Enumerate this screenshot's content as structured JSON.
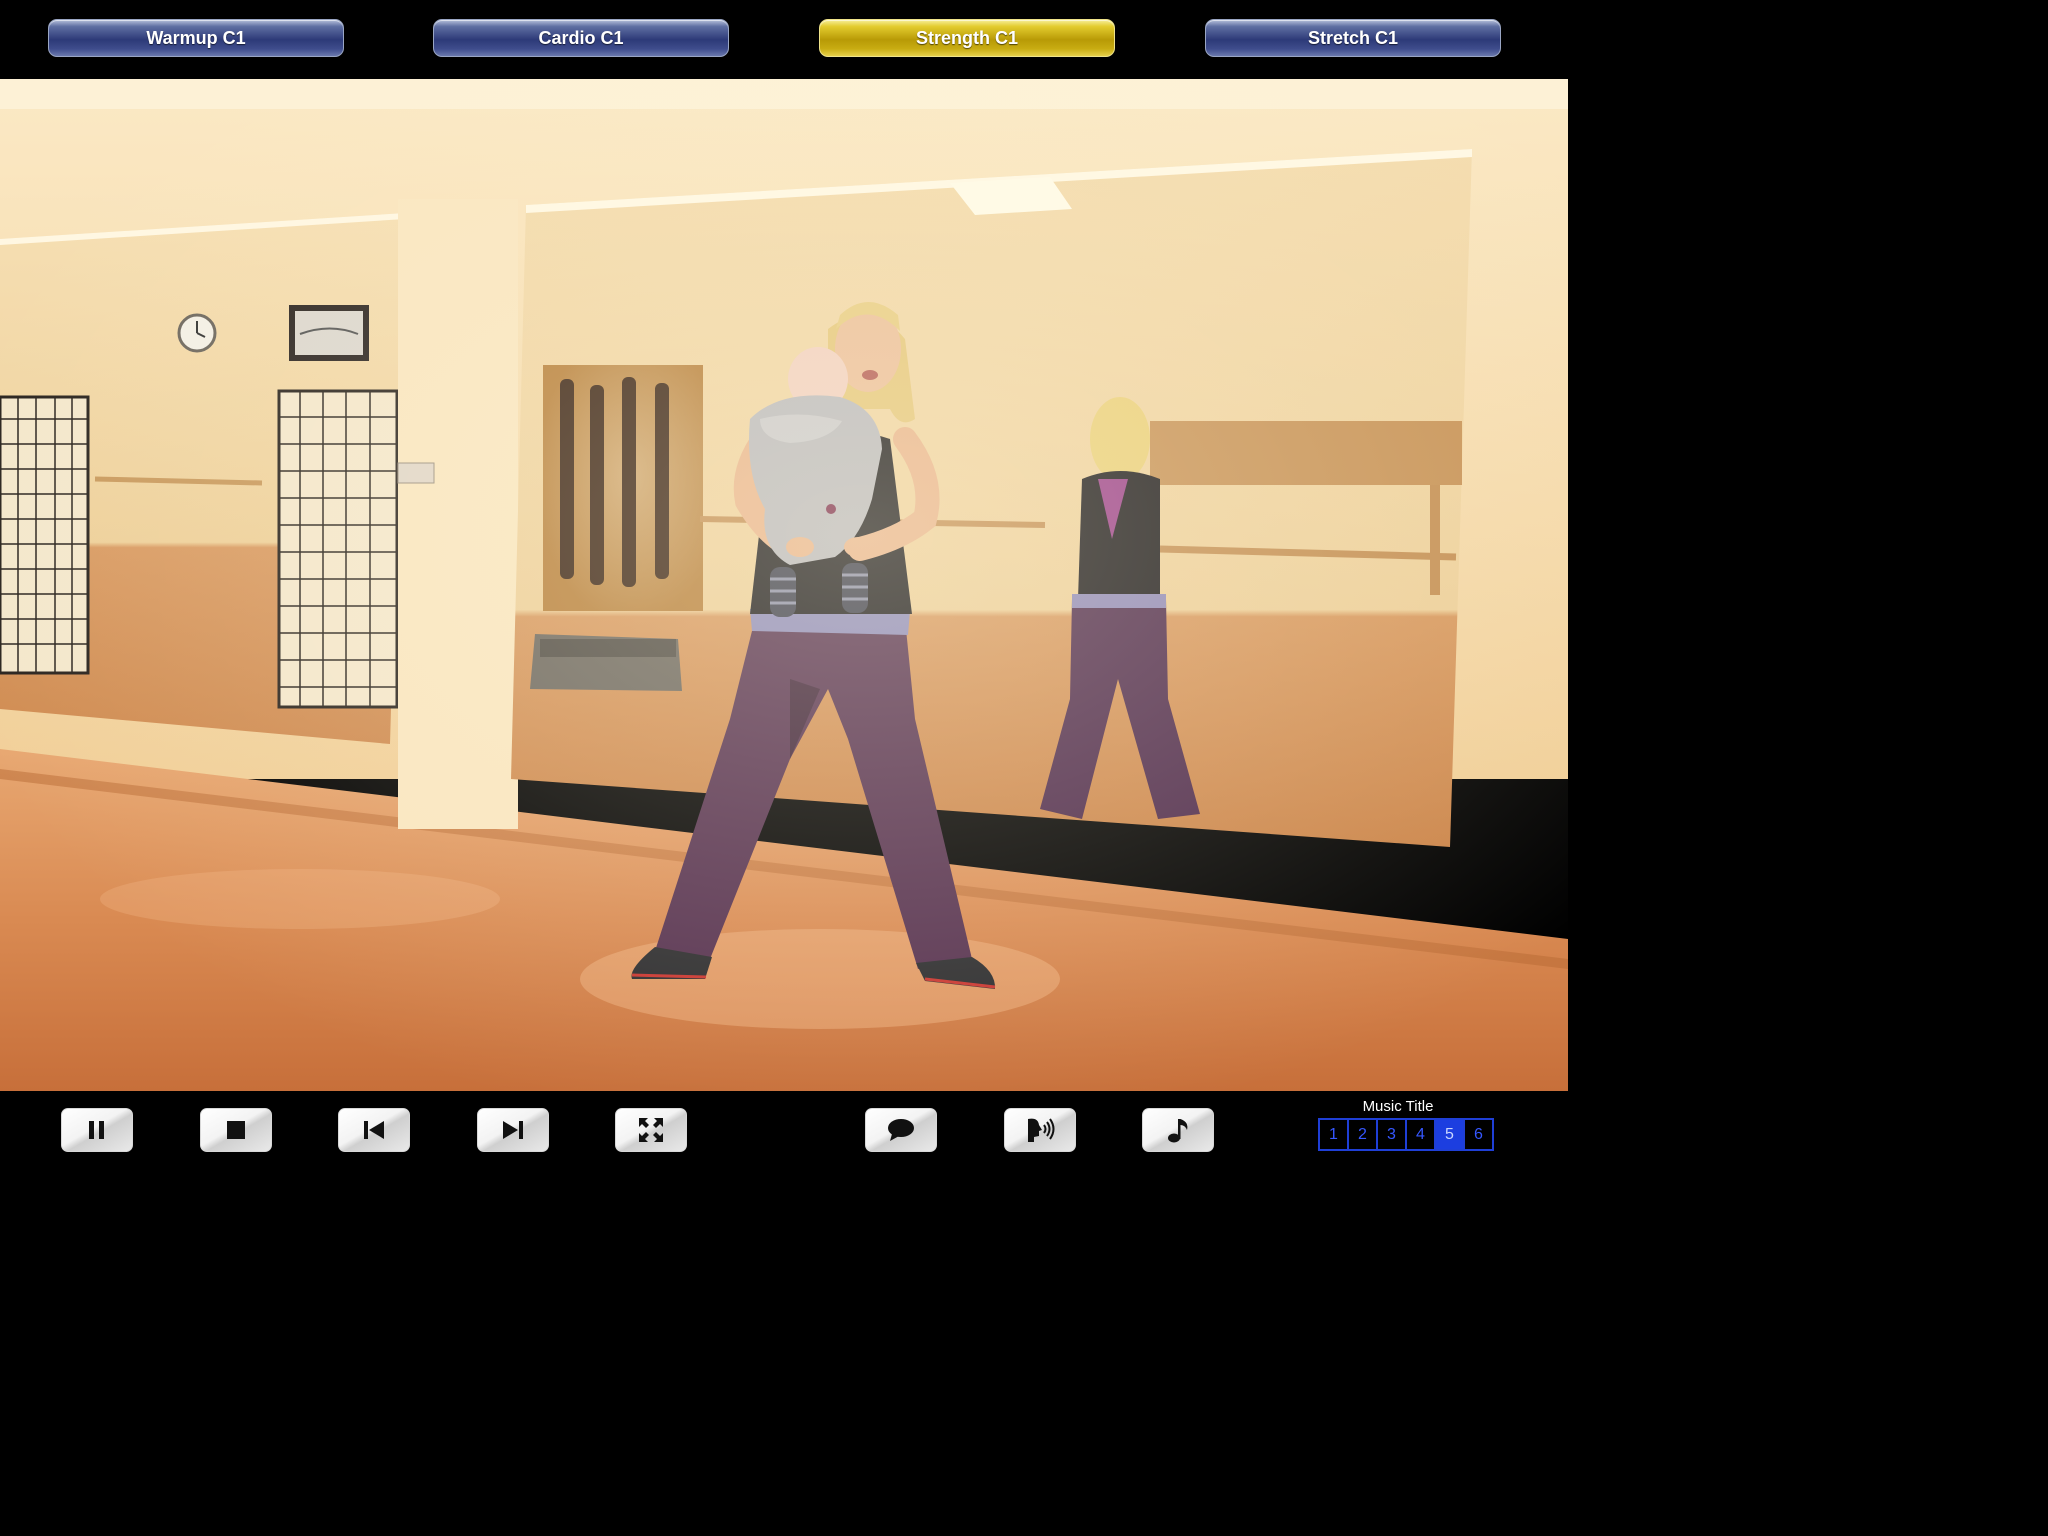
{
  "categories": [
    {
      "label": "Warmup C1",
      "active": false
    },
    {
      "label": "Cardio C1",
      "active": false
    },
    {
      "label": "Strength C1",
      "active": true
    },
    {
      "label": "Stretch C1",
      "active": false
    }
  ],
  "controls": {
    "buttons": [
      {
        "name": "pause-button",
        "icon": "pause-icon"
      },
      {
        "name": "stop-button",
        "icon": "stop-icon"
      },
      {
        "name": "previous-button",
        "icon": "skip-back-icon"
      },
      {
        "name": "next-button",
        "icon": "skip-forward-icon"
      },
      {
        "name": "fullscreen-button",
        "icon": "fullscreen-icon"
      },
      {
        "name": "subtitles-button",
        "icon": "speech-bubble-icon"
      },
      {
        "name": "voice-button",
        "icon": "speaking-head-icon"
      },
      {
        "name": "music-button",
        "icon": "music-note-icon"
      }
    ]
  },
  "music": {
    "title_label": "Music Title",
    "tracks": [
      "1",
      "2",
      "3",
      "4",
      "5",
      "6"
    ],
    "selected": "5"
  },
  "colors": {
    "active_category": "#d4b81a",
    "inactive_category": "#2d3a78",
    "track_border": "#1f3fd6",
    "track_active": "#1c3ee0"
  }
}
